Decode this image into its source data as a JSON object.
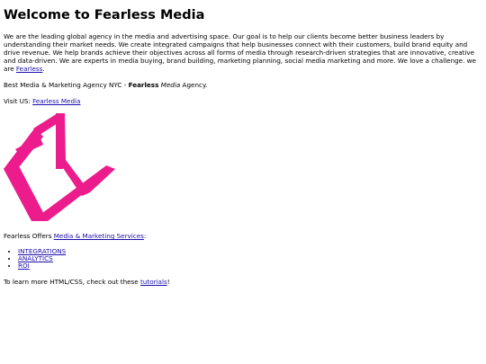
{
  "page": {
    "heading": "Welcome to Fearless Media",
    "intro": "We are the leading global agency in the media and advertising space. Our goal is to help our clients become better business leaders by understanding their market needs. We create integrated campaigns that help businesses connect with their customers, build brand equity and drive revenue. We help brands achieve their objectives across all forms of media through research-driven strategies that are innovative, creative and data-driven. We are experts in media buying, brand building, marketing planning, social media marketing and more. We love a challenge. we are ",
    "intro_link": "Fearless",
    "intro_end": ".",
    "tagline_start": "Best Media & Marketing Agency NYC - ",
    "tagline_bold": "Fearless",
    "tagline_space": " ",
    "tagline_italic": "Media",
    "tagline_end": " Agency.",
    "visit_label": "Visit US: ",
    "visit_link": "Fearless Media",
    "offers_label": "Fearless Offers ",
    "offers_link": "Media & Marketing Services",
    "offers_end": ":",
    "services": [
      "INTEGRATIONS",
      "ANALYTICS",
      "ROI"
    ],
    "learn_start": "To learn more HTML/CSS, check out these ",
    "learn_link": "tutorials",
    "learn_end": "!"
  },
  "logo": {
    "icon": "fearless-media-logo-icon",
    "color": "#ec1c8c"
  }
}
